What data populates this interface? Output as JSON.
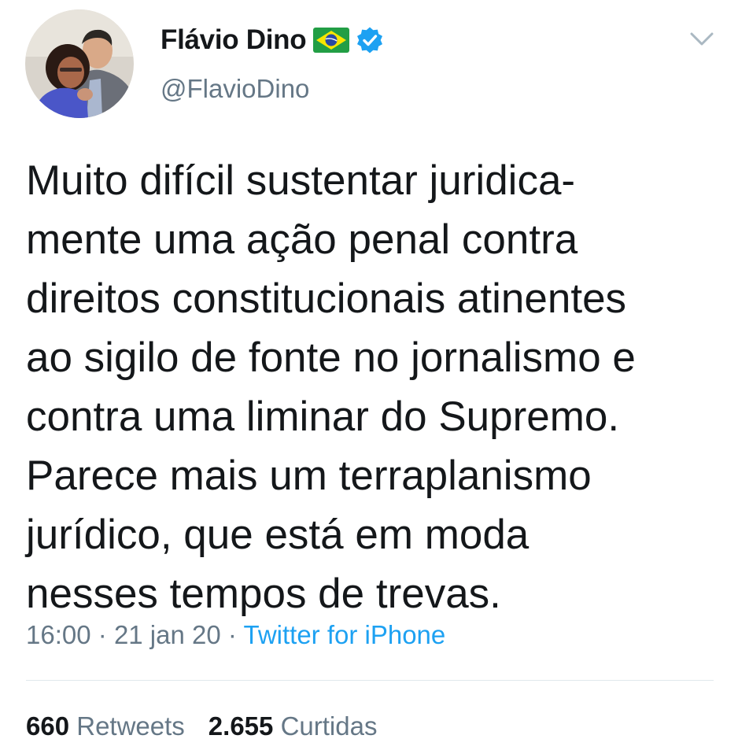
{
  "user": {
    "display_name": "Flávio Dino",
    "handle": "@FlavioDino",
    "flag_icon": "brazil-flag-icon",
    "verified_icon": "verified-badge-icon",
    "avatar_icon": "profile-photo"
  },
  "tweet": {
    "lines": [
      "Muito difícil sustentar juridica-",
      "mente uma ação penal contra",
      "direitos constitucionais atinentes",
      "ao sigilo de fonte no jornalismo e",
      "contra uma liminar do Supremo.",
      "Parece mais um terraplanismo",
      "jurídico, que está em moda",
      "nesses tempos de trevas."
    ]
  },
  "meta": {
    "time": "16:00",
    "separator": "·",
    "date": "21 jan 20",
    "source": "Twitter for iPhone"
  },
  "stats": {
    "retweets_count": "660",
    "retweets_label": "Retweets",
    "likes_count": "2.655",
    "likes_label": "Curtidas"
  },
  "colors": {
    "text": "#14171a",
    "secondary": "#657786",
    "link": "#1da1f2",
    "divider": "#e1e8ed"
  }
}
